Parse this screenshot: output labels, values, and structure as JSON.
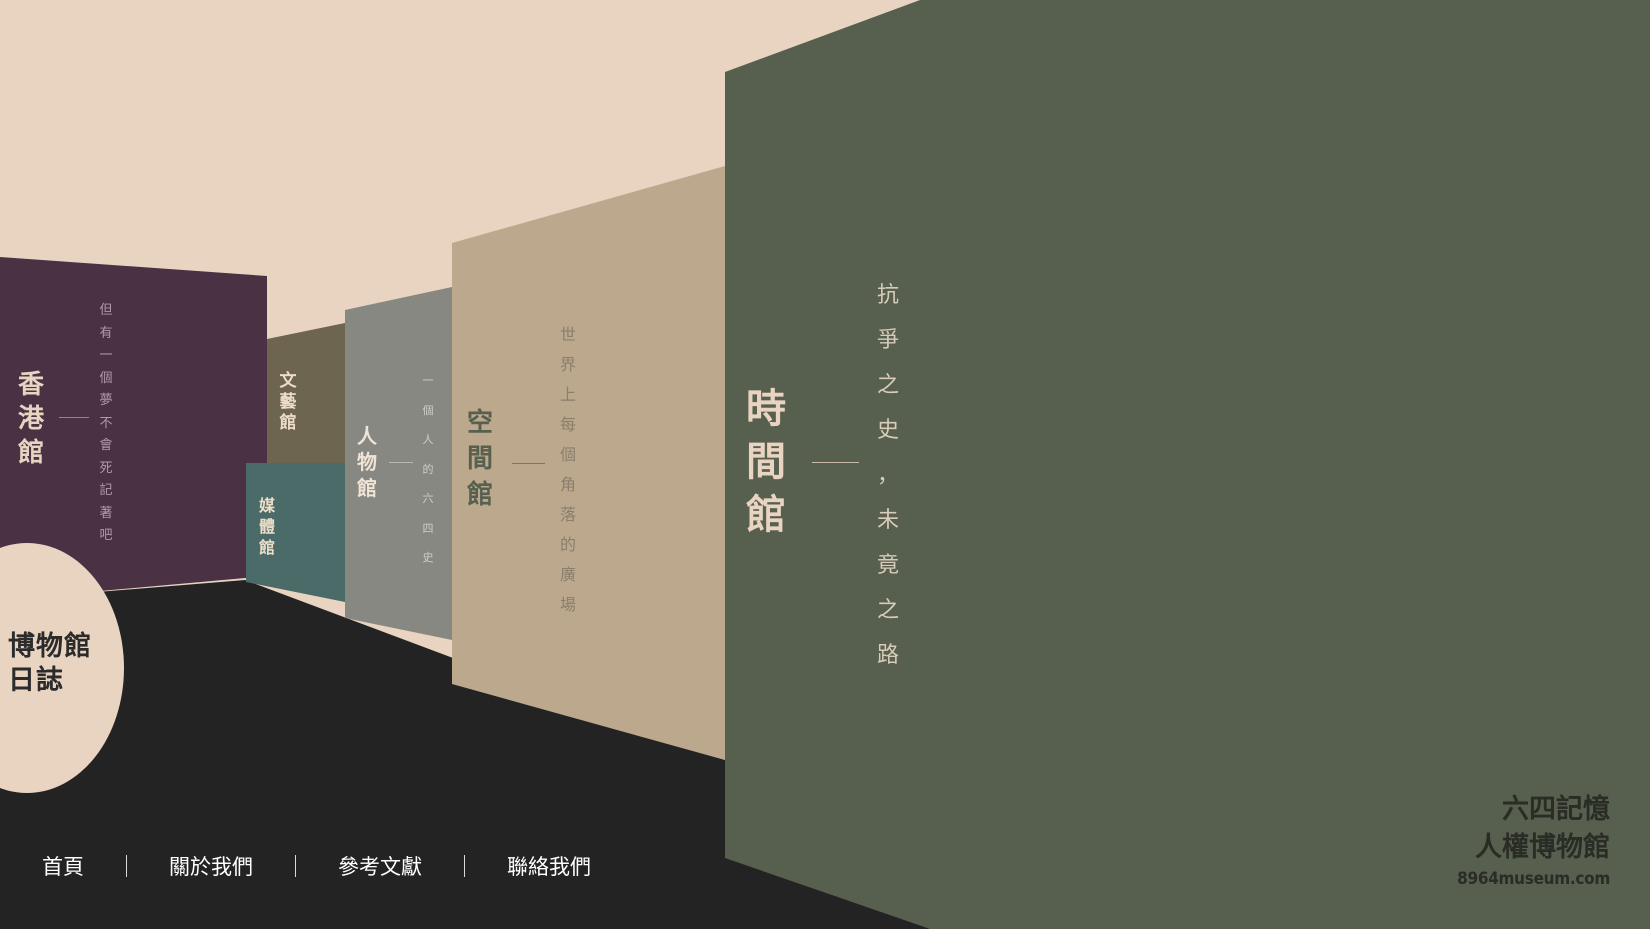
{
  "colors": {
    "sky": "#e9d3c1",
    "floor": "#232323",
    "hong_kong": "#4a3144",
    "literature_art": "#6e6550",
    "media": "#4b6b68",
    "people": "#888883",
    "space": "#bca98d",
    "time": "#575f4e",
    "light_text": "#e9d3c1",
    "dark_text": "#2a2c26"
  },
  "halls": {
    "hong_kong": {
      "title": "香港館",
      "tagline": "但有一個夢不會死記著吧"
    },
    "literature_art": {
      "title": "文藝館"
    },
    "media": {
      "title": "媒體館"
    },
    "people": {
      "title": "人物館",
      "tagline": "一個人的六四史"
    },
    "space": {
      "title": "空間館",
      "tagline": "世界上每個角落的廣場"
    },
    "time": {
      "title": "時間館",
      "tagline": "抗爭之史，未竟之路"
    }
  },
  "journal": {
    "label": "博物館日誌"
  },
  "nav": [
    {
      "label": "首頁"
    },
    {
      "label": "關於我們"
    },
    {
      "label": "參考文獻"
    },
    {
      "label": "聯絡我們"
    }
  ],
  "brand": {
    "line1": "六四記憶",
    "line2": "人權博物館",
    "url": "8964museum.com"
  }
}
